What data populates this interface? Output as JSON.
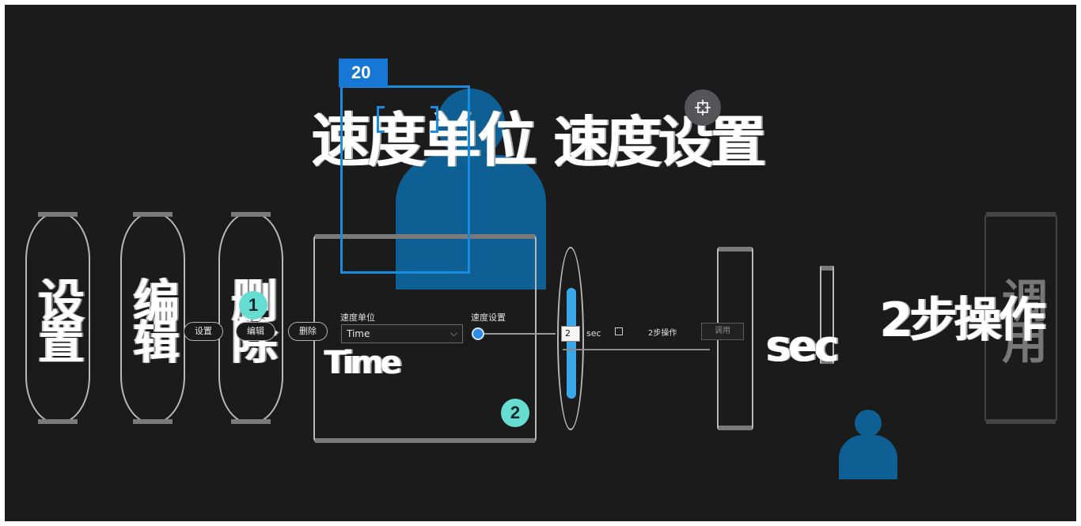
{
  "detection": {
    "tag": "20"
  },
  "toolbar": {
    "settings_label": "设置",
    "edit_label": "编辑",
    "delete_label": "删除"
  },
  "speed_unit": {
    "label": "速度单位",
    "value": "Time"
  },
  "speed_setting": {
    "label": "速度设置",
    "value": "2",
    "unit": "sec",
    "fraction": 0.0
  },
  "two_step": {
    "label": "2步操作",
    "checked": false
  },
  "apply_label": "调用",
  "steps": [
    "1",
    "2"
  ],
  "colors": {
    "accent": "#1a8ce0",
    "person": "#0d5f94",
    "badge": "#66ddd0",
    "background": "#1b1b1b"
  },
  "icons": {
    "crosshair": "crosshair-icon",
    "chevron": "chevron-down-icon"
  }
}
